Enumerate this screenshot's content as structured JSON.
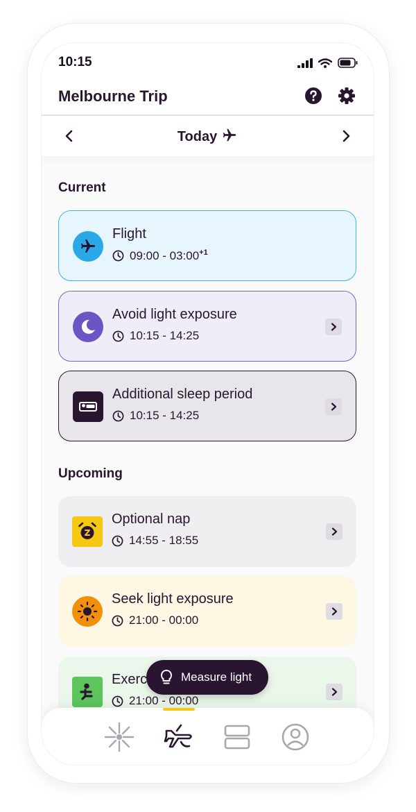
{
  "status_bar": {
    "time": "10:15"
  },
  "header": {
    "title": "Melbourne Trip",
    "help_icon": "help-circle-icon",
    "settings_icon": "gear-icon"
  },
  "date_nav": {
    "label": "Today",
    "prev_icon": "chevron-left-icon",
    "next_icon": "chevron-right-icon"
  },
  "sections": {
    "current": "Current",
    "upcoming": "Upcoming"
  },
  "cards": [
    {
      "title": "Flight",
      "time": "09:00 - 03:00",
      "time_suffix": "+1",
      "icon": "airplane-icon",
      "bg": "#e7f6fd",
      "border": "#39b4ea",
      "icon_bg": "#2aa8e8"
    },
    {
      "title": "Avoid light exposure",
      "time": "10:15 - 14:25",
      "icon": "moon-icon",
      "bg": "#efedf8",
      "border": "#7a62c9",
      "icon_bg": "#6b55c4"
    },
    {
      "title": "Additional sleep period",
      "time": "10:15 - 14:25",
      "icon": "bed-icon",
      "bg": "#e8e6ea",
      "border": "#2a1530",
      "icon_bg": "#2a1530"
    },
    {
      "title": "Optional nap",
      "time": "14:55 - 18:55",
      "icon": "alarm-clock-icon",
      "bg": "#efeef1",
      "border": "none",
      "icon_bg": "#f7c811"
    },
    {
      "title": "Seek light exposure",
      "time": "21:00 - 00:00",
      "icon": "sun-icon",
      "bg": "#fdf7e4",
      "border": "none",
      "icon_bg": "#f2900c"
    },
    {
      "title": "Exercise",
      "time": "21:00 - 00:00",
      "icon": "exercise-icon",
      "bg": "#eaf7ea",
      "border": "none",
      "icon_bg": "#5cc55c"
    }
  ],
  "fab": {
    "label": "Measure light",
    "icon": "lightbulb-icon"
  },
  "bottom_nav": [
    {
      "name": "light-icon"
    },
    {
      "name": "trip-icon",
      "active": true
    },
    {
      "name": "layout-icon"
    },
    {
      "name": "profile-icon"
    }
  ],
  "colors": {
    "primary": "#2a1530",
    "accent": "#f5c518"
  }
}
